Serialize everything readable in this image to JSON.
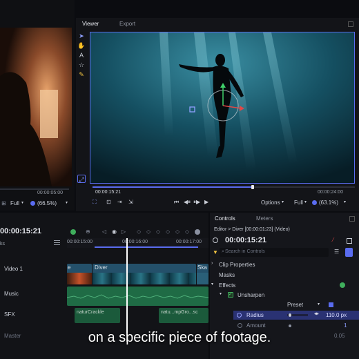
{
  "left_viewer": {
    "timecode": "00:00:05:00",
    "quality": "Full",
    "zoom": "(66.5%)"
  },
  "viewer": {
    "tabs": [
      "Viewer",
      "Export"
    ],
    "timecode_left": "00:00:15:21",
    "timecode_right": "00:00:24:00",
    "options": "Options",
    "quality": "Full",
    "zoom": "(63.1%)",
    "tools": [
      "select-arrow-icon",
      "hand-icon",
      "text-tool-icon",
      "star-shape-icon",
      "pencil-icon"
    ]
  },
  "timeline": {
    "timecode": "00:00:15:21",
    "ruler": [
      "00:00:15:00",
      "00:00:16:00",
      "00:00:17:00"
    ],
    "tracks": [
      "Video 1",
      "Music",
      "SFX",
      "Master"
    ],
    "tracks_header": "ks",
    "clips": {
      "video_left": "e",
      "video_diver": "Diver",
      "video_right": "Ska",
      "sfx_a": "naturCrackle",
      "sfx_b": "natu...mpGro...sc"
    }
  },
  "controls": {
    "tabs": [
      "Controls",
      "Meters"
    ],
    "breadcrumb": "Editor > Diver [00:00:01:23] (Video)",
    "timecode": "00:00:15:21",
    "search_placeholder": "Search in Controls",
    "items": {
      "clip_properties": "Clip Properties",
      "masks": "Masks",
      "effects": "Effects",
      "unsharpen": "Unsharpen",
      "preset": "Preset",
      "radius": "Radius",
      "radius_value": "110.0 px",
      "amount": "Amount",
      "amount_value": "1",
      "extra_value": "0.05"
    }
  },
  "subtitle": "on a specific piece of footage.",
  "colors": {
    "accent": "#5a6cf0",
    "green": "#3fae5c",
    "playhead": "#ffffff"
  }
}
